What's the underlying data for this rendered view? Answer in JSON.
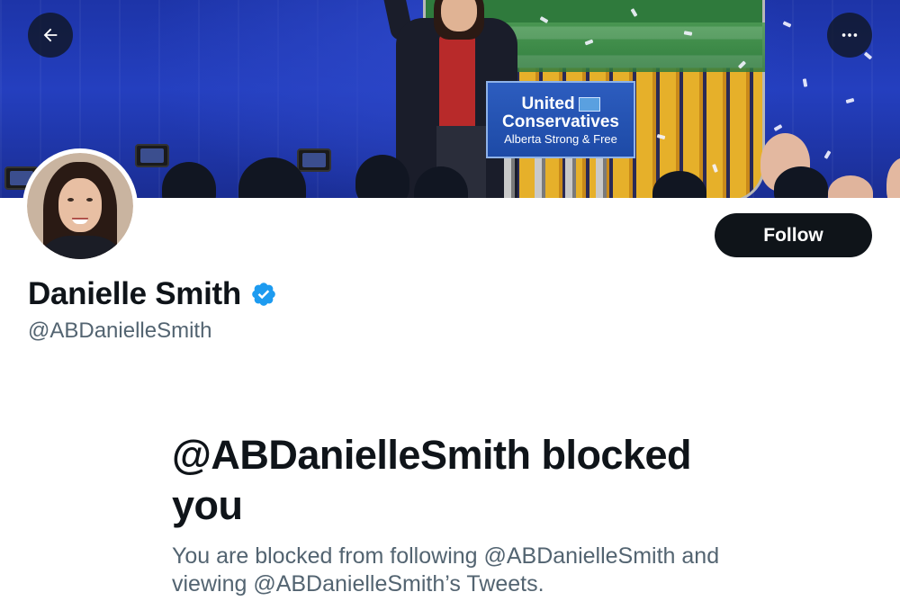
{
  "header": {
    "back_icon": "arrow-left-icon",
    "more_icon": "more-horizontal-icon"
  },
  "banner": {
    "podium_line1": "United",
    "podium_line2": "Conservatives",
    "podium_line3": "Alberta Strong & Free"
  },
  "profile": {
    "display_name": "Danielle Smith",
    "handle": "@ABDanielleSmith",
    "verified": true,
    "verified_color": "#1d9bf0",
    "follow_label": "Follow"
  },
  "blocked": {
    "title": "@ABDanielleSmith blocked you",
    "description": "You are blocked from following @ABDanielleSmith and viewing @ABDanielleSmith’s Tweets."
  },
  "colors": {
    "text_primary": "#0f1419",
    "text_secondary": "#536471",
    "button_dark": "#0f1419"
  }
}
